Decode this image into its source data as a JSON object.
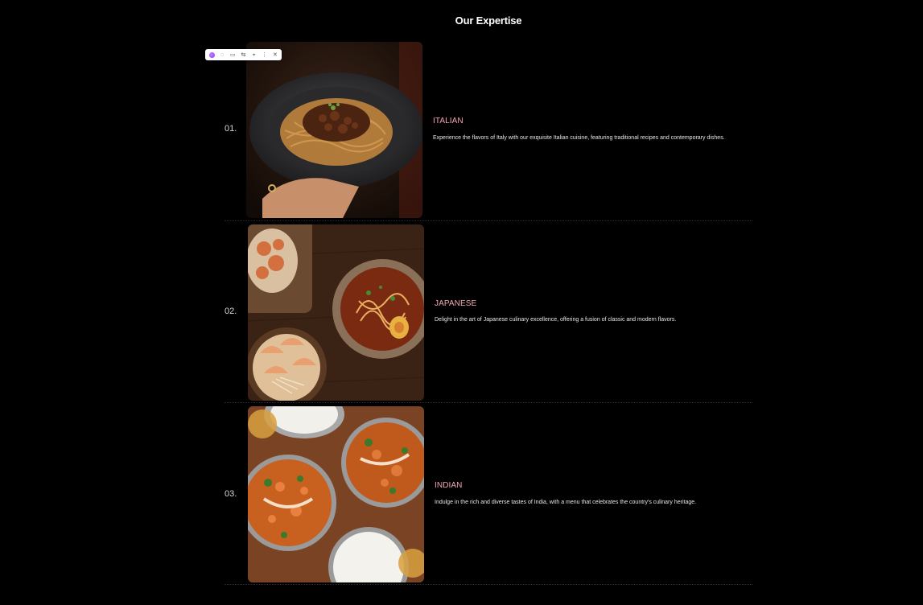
{
  "section": {
    "title": "Our Expertise"
  },
  "toolbar": {
    "icons": [
      "app-logo-icon",
      "comment-icon",
      "chat-icon",
      "translate-icon",
      "pin-icon",
      "more-icon",
      "close-icon"
    ],
    "glyphs": {
      "comment": "◌",
      "chat": "▭",
      "translate": "⇆",
      "pin": "⌖",
      "more": "⋮",
      "close": "✕"
    }
  },
  "items": [
    {
      "number": "01.",
      "name": "ITALIAN",
      "description": "Experience the flavors of Italy with our exquisite Italian cuisine, featuring traditional recipes and contemporary dishes.",
      "image": "pasta-bowl-photo"
    },
    {
      "number": "02.",
      "name": "JAPANESE",
      "description": "Delight in the art of Japanese culinary excellence, offering a fusion of classic and modern flavors.",
      "image": "ramen-gyoza-photo"
    },
    {
      "number": "03.",
      "name": "INDIAN",
      "description": "Indulge in the rich and diverse tastes of India, with a menu that celebrates the country's culinary heritage.",
      "image": "curry-rice-photo"
    }
  ],
  "colors": {
    "background": "#000000",
    "accent": "#f4a7b5",
    "text": "#ffffff"
  }
}
